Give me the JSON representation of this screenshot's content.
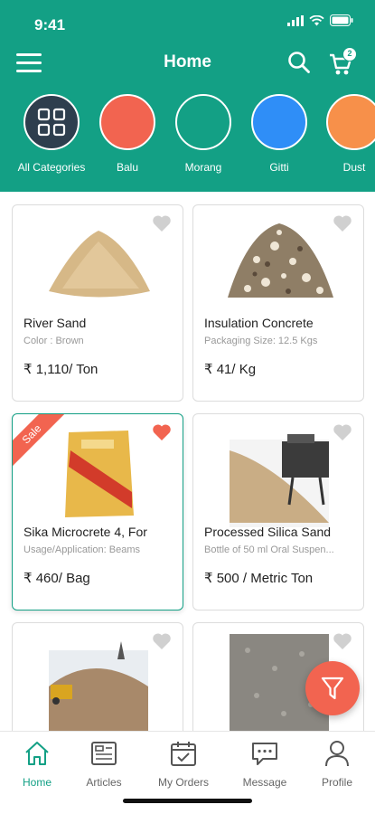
{
  "status_bar": {
    "time": "9:41"
  },
  "header": {
    "title": "Home",
    "cart_count": "2"
  },
  "colors": {
    "brand": "#13a085",
    "accent": "#f26450",
    "dark": "#2e3e4e"
  },
  "categories": [
    {
      "label": "All Categories",
      "color": "#2e3e4e",
      "icon": "grid-icon"
    },
    {
      "label": "Balu",
      "color": "#f26450"
    },
    {
      "label": "Morang",
      "color": "#13a085"
    },
    {
      "label": "Gitti",
      "color": "#2f8ef7"
    },
    {
      "label": "Dust",
      "color": "#f7904a"
    }
  ],
  "products": [
    {
      "name": "River Sand",
      "detail": "Color : Brown",
      "price": "₹ 1,110/ Ton",
      "favorite": false,
      "sale": false
    },
    {
      "name": "Insulation Concrete",
      "detail": "Packaging Size: 12.5 Kgs",
      "price": "₹ 41/ Kg",
      "favorite": false,
      "sale": false
    },
    {
      "name": "Sika Microcrete 4, For",
      "detail": "Usage/Application: Beams",
      "price": "₹ 460/ Bag",
      "favorite": true,
      "sale": true,
      "sale_label": "Sale"
    },
    {
      "name": "Processed Silica Sand",
      "detail": "Bottle of 50 ml Oral Suspen...",
      "price": "₹ 500 / Metric Ton",
      "favorite": false,
      "sale": false
    },
    {
      "name": "",
      "detail": "",
      "price": "",
      "favorite": false,
      "sale": false
    },
    {
      "name": "",
      "detail": "",
      "price": "",
      "favorite": false,
      "sale": false
    }
  ],
  "tabs": [
    {
      "label": "Home",
      "icon": "home-icon",
      "active": true
    },
    {
      "label": "Articles",
      "icon": "articles-icon",
      "active": false
    },
    {
      "label": "My Orders",
      "icon": "calendar-check-icon",
      "active": false
    },
    {
      "label": "Message",
      "icon": "message-icon",
      "active": false
    },
    {
      "label": "Profile",
      "icon": "profile-icon",
      "active": false
    }
  ]
}
